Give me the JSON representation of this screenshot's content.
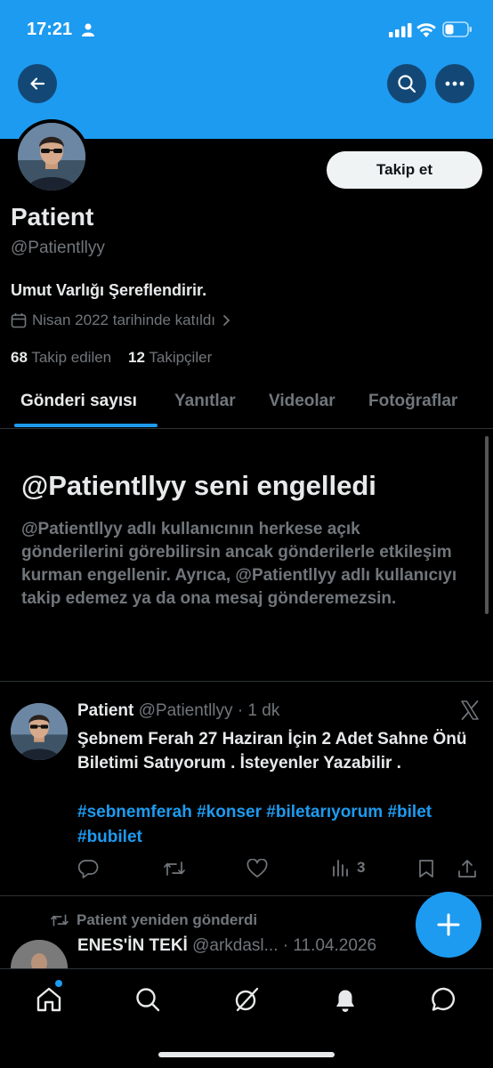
{
  "status_bar": {
    "time": "17:21"
  },
  "profile": {
    "name": "Patient",
    "handle": "@Patientllyy",
    "bio": "Umut Varlığı Şereflendirir.",
    "joined": "Nisan 2022 tarihinde katıldı",
    "following_count": "68",
    "following_label": "Takip edilen",
    "followers_count": "12",
    "followers_label": "Takipçiler",
    "follow_button": "Takip et"
  },
  "tabs": [
    {
      "label": "Gönderi sayısı",
      "active": true
    },
    {
      "label": "Yanıtlar",
      "active": false
    },
    {
      "label": "Videolar",
      "active": false
    },
    {
      "label": "Fotoğraflar",
      "active": false
    }
  ],
  "blocked": {
    "title": "@Patientllyy seni engelledi",
    "text": "@Patientllyy adlı kullanıcının herkese açık gönderilerini görebilirsin ancak gönderilerle etkileşim kurman engellenir. Ayrıca, @Patientllyy adlı kullanıcıyı takip edemez ya da ona mesaj gönderemezsin."
  },
  "tweet": {
    "author": "Patient",
    "handle": "@Patientllyy",
    "time": "· 1 dk",
    "text": "Şebnem Ferah 27 Haziran İçin 2 Adet Sahne Önü Biletimi Satıyorum . İsteyenler Yazabilir .",
    "hashtags": "#sebnemferah #konser #biletarıyorum #bilet #bubilet",
    "views": "3"
  },
  "retweet": {
    "label": "Patient yeniden gönderdi",
    "author": "ENES'İN TEKİ",
    "handle": "@arkdasl...",
    "time": "· 11.04.2026"
  },
  "colors": {
    "accent": "#1d9bf0",
    "background": "#000000",
    "muted": "#71767b",
    "text": "#e7e9ea"
  }
}
